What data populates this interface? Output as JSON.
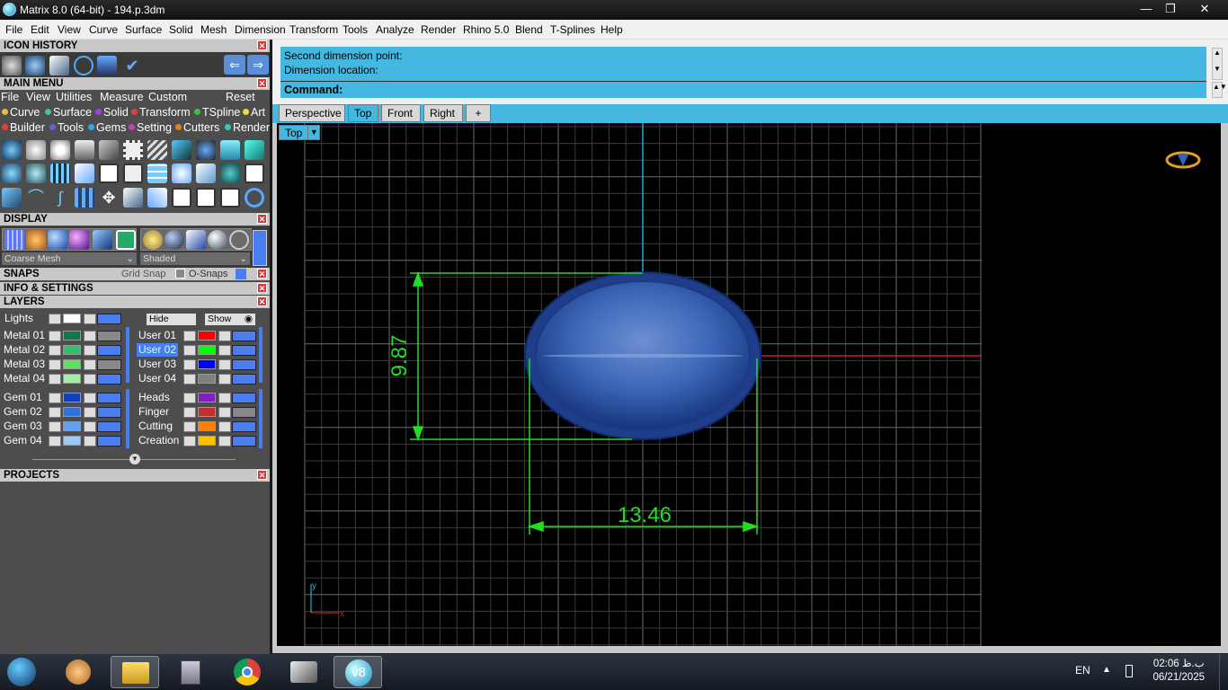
{
  "window": {
    "title": "Matrix 8.0 (64-bit) - 194.p.3dm"
  },
  "menubar": [
    "File",
    "Edit",
    "View",
    "Curve",
    "Surface",
    "Solid",
    "Mesh",
    "Dimension",
    "Transform",
    "Tools",
    "Analyze",
    "Render",
    "Rhino 5.0",
    "Blend",
    "T-Splines",
    "Help"
  ],
  "panels": {
    "icon_history": "ICON HISTORY",
    "main_menu": "MAIN MENU",
    "display": "DISPLAY",
    "snaps": "SNAPS",
    "info_settings": "INFO & SETTINGS",
    "layers": "LAYERS",
    "projects": "PROJECTS"
  },
  "main_menu": {
    "row1": [
      "File",
      "View",
      "Utilities",
      "Measure",
      "Custom"
    ],
    "reset": "Reset",
    "row2": [
      {
        "label": "Curve",
        "color": "#e0c040"
      },
      {
        "label": "Surface",
        "color": "#40c0a0"
      },
      {
        "label": "Solid",
        "color": "#a040e0"
      },
      {
        "label": "Transform",
        "color": "#e04040"
      },
      {
        "label": "TSpline",
        "color": "#40c040"
      },
      {
        "label": "Art",
        "color": "#e0e040"
      }
    ],
    "row3": [
      {
        "label": "Builder",
        "color": "#e04040"
      },
      {
        "label": "Tools",
        "color": "#6060e0"
      },
      {
        "label": "Gems",
        "color": "#40a0e0"
      },
      {
        "label": "Setting",
        "color": "#c040c0"
      },
      {
        "label": "Cutters",
        "color": "#e08020"
      },
      {
        "label": "Render",
        "color": "#40c0c0"
      }
    ]
  },
  "display": {
    "mesh_select": "Coarse Mesh",
    "shade_select": "Shaded"
  },
  "snaps": {
    "grid_snap": "Grid Snap",
    "o_snaps": "O-Snaps"
  },
  "layers": {
    "lights": "Lights",
    "hide": "Hide",
    "show": "Show",
    "left": [
      {
        "name": "Metal 01",
        "color": "#0a7a4a"
      },
      {
        "name": "Metal 02",
        "color": "#30c070"
      },
      {
        "name": "Metal 03",
        "color": "#60e060"
      },
      {
        "name": "Metal 04",
        "color": "#a0f0a0"
      },
      {
        "name": "Gem 01",
        "color": "#1040c0"
      },
      {
        "name": "Gem 02",
        "color": "#3070e0"
      },
      {
        "name": "Gem 03",
        "color": "#60a0f0"
      },
      {
        "name": "Gem 04",
        "color": "#a0c8f0"
      }
    ],
    "right": [
      {
        "name": "User 01",
        "color": "#ff0000"
      },
      {
        "name": "User 02",
        "color": "#00ff00"
      },
      {
        "name": "User 03",
        "color": "#0000ff"
      },
      {
        "name": "User 04",
        "color": "#808080"
      },
      {
        "name": "Heads",
        "color": "#8020c0"
      },
      {
        "name": "Finger",
        "color": "#c03030"
      },
      {
        "name": "Cutting",
        "color": "#ff8000"
      },
      {
        "name": "Creation",
        "color": "#ffc000"
      }
    ]
  },
  "command": {
    "history_line1": "Second dimension point:",
    "history_line2": "Dimension location:",
    "prompt": "Command:"
  },
  "viewport_tabs": [
    "Perspective",
    "Top",
    "Front",
    "Right"
  ],
  "active_tab": "Top",
  "add_tab": "+",
  "viewport": {
    "label": "Top",
    "dim_vertical": "9.87",
    "dim_horizontal": "13.46",
    "axis_x": "x",
    "axis_y": "y"
  },
  "colors": {
    "accent": "#44b8e0",
    "dimension": "#22dd22",
    "object": "#2a4d9a"
  },
  "taskbar": {
    "language": "EN",
    "time": "02:06 ب.ظ",
    "date": "06/21/2025"
  }
}
